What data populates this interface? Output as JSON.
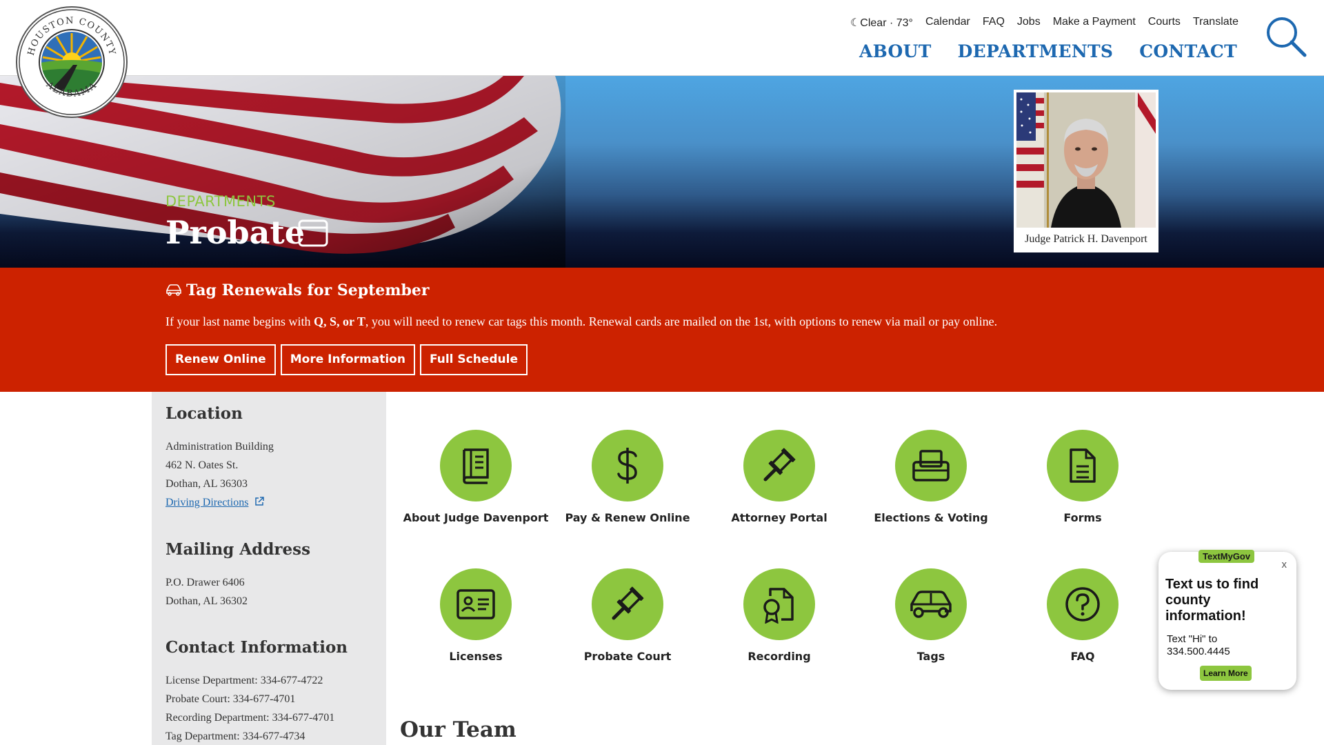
{
  "logo": {
    "top_text": "HOUSTON COUNTY",
    "bottom_text": "ALABAMA"
  },
  "utility_nav": {
    "weather": "Clear · 73°",
    "items": [
      "Calendar",
      "FAQ",
      "Jobs",
      "Make a Payment",
      "Courts",
      "Translate"
    ]
  },
  "main_nav": [
    "ABOUT",
    "DEPARTMENTS",
    "CONTACT"
  ],
  "hero": {
    "eyebrow": "DEPARTMENTS",
    "title": "Probate",
    "judge_caption": "Judge Patrick H. Davenport"
  },
  "alert": {
    "title": "Tag Renewals for September",
    "text_before": "If your last name begins with ",
    "text_bold": "Q, S, or T",
    "text_after": ", you will need to renew car tags this month. Renewal cards are mailed on the 1st, with options to renew via mail or pay online.",
    "buttons": [
      "Renew Online",
      "More Information",
      "Full Schedule"
    ]
  },
  "sidebar": {
    "location_heading": "Location",
    "location_lines": [
      "Administration Building",
      "462 N. Oates St.",
      "Dothan, AL 36303"
    ],
    "driving_directions": "Driving Directions",
    "mailing_heading": "Mailing Address",
    "mailing_lines": [
      "P.O. Drawer 6406",
      "Dothan, AL 36302"
    ],
    "contact_heading": "Contact Information",
    "contact_lines": [
      "License Department: 334-677-4722",
      "Probate Court: 334-677-4701",
      "Recording Department: 334-677-4701",
      "Tag Department: 334-677-4734"
    ]
  },
  "quick_links": [
    {
      "label": "About Judge Davenport",
      "icon": "book-icon"
    },
    {
      "label": "Pay & Renew Online",
      "icon": "dollar-icon"
    },
    {
      "label": "Attorney Portal",
      "icon": "gavel-icon"
    },
    {
      "label": "Elections & Voting",
      "icon": "ballot-box-icon"
    },
    {
      "label": "Forms",
      "icon": "document-icon"
    },
    {
      "label": "Licenses",
      "icon": "id-card-icon"
    },
    {
      "label": "Probate Court",
      "icon": "gavel-icon"
    },
    {
      "label": "Recording",
      "icon": "certificate-icon"
    },
    {
      "label": "Tags",
      "icon": "car-icon"
    },
    {
      "label": "FAQ",
      "icon": "question-icon"
    }
  ],
  "our_team_heading": "Our Team",
  "textmygov": {
    "badge": "TextMyGov",
    "close": "x",
    "heading": "Text us to find county information!",
    "body_line1": "Text \"Hi\" to",
    "body_line2": "334.500.4445",
    "learn_more": "Learn More"
  },
  "colors": {
    "accent_green": "#8dc63f",
    "nav_blue": "#1d68b0",
    "alert_red": "#cc2200",
    "sidebar_gray": "#e8e8e9"
  }
}
